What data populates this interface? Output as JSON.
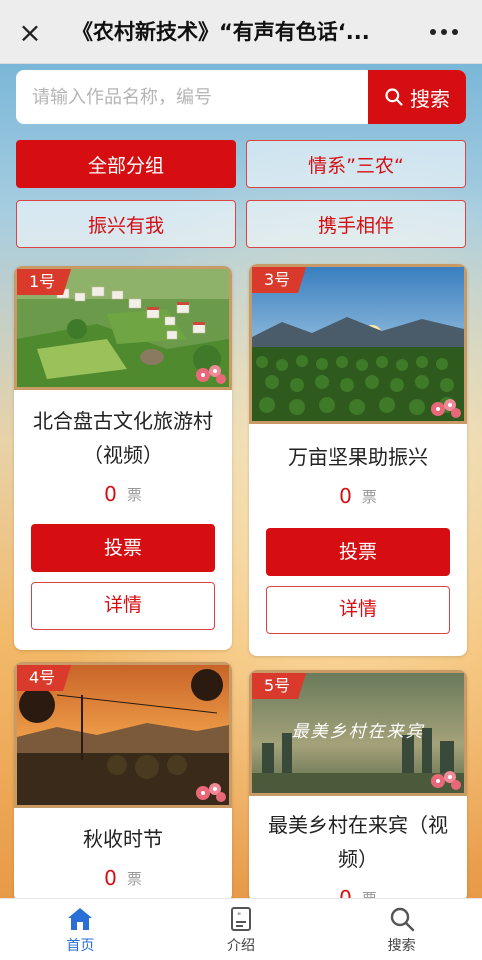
{
  "header": {
    "title": "《农村新技术》“有声有色话‘...",
    "close_icon": "×"
  },
  "search": {
    "placeholder": "请输入作品名称，编号",
    "button_label": "搜索"
  },
  "categories": [
    {
      "label": "全部分组",
      "active": true
    },
    {
      "label": "情系”三农“",
      "active": false
    },
    {
      "label": "振兴有我",
      "active": false
    },
    {
      "label": "携手相伴",
      "active": false
    }
  ],
  "entries": [
    {
      "badge": "1号",
      "title": "北合盘古文化旅游村（视频）",
      "votes": "0",
      "vote_unit": "票",
      "vote_label": "投票",
      "detail_label": "详情"
    },
    {
      "badge": "3号",
      "title": "万亩坚果助振兴",
      "votes": "0",
      "vote_unit": "票",
      "vote_label": "投票",
      "detail_label": "详情"
    },
    {
      "badge": "4号",
      "title": "秋收时节",
      "votes": "0",
      "vote_unit": "票"
    },
    {
      "badge": "5号",
      "title": "最美乡村在来宾（视频）",
      "votes": "0",
      "vote_unit": "票",
      "image_text": "最美乡村在来宾"
    }
  ],
  "bottom_nav": [
    {
      "label": "首页",
      "icon": "home-icon",
      "active": true
    },
    {
      "label": "介绍",
      "icon": "intro-icon",
      "active": false
    },
    {
      "label": "搜索",
      "icon": "search-icon",
      "active": false
    }
  ],
  "colors": {
    "primary": "#d60e12",
    "nav_active": "#2a6fd6"
  }
}
